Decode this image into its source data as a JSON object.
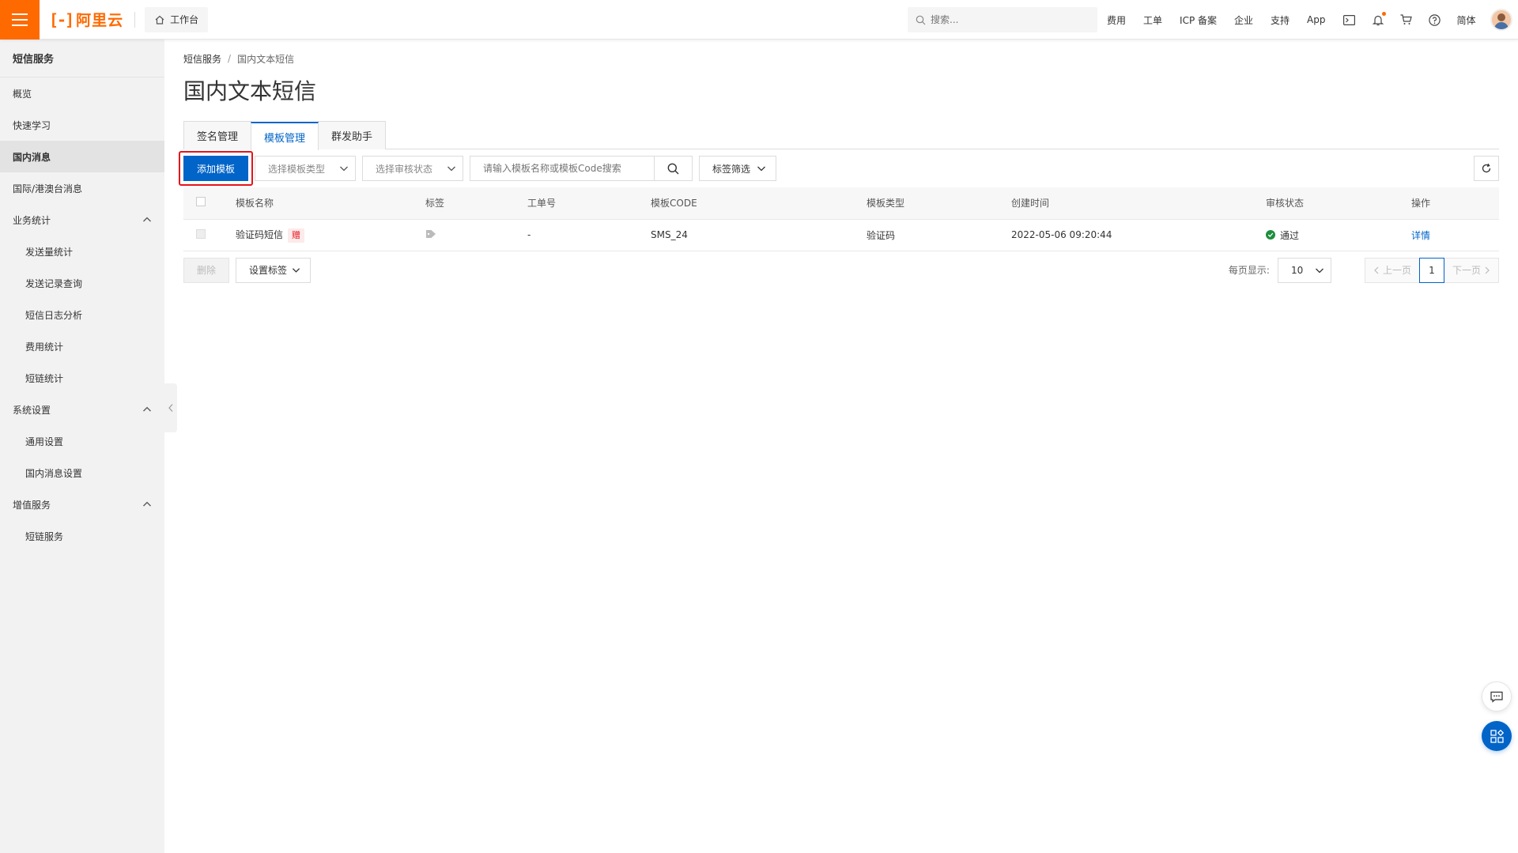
{
  "colors": {
    "brand": "#ff6a00",
    "primary": "#0064c8",
    "highlight": "#e4141c",
    "success": "#1e8e3e"
  },
  "topbar": {
    "logo_mark": "[-]",
    "logo_text": "阿里云",
    "workbench": "工作台",
    "search_placeholder": "搜索...",
    "links": [
      "费用",
      "工单",
      "ICP 备案",
      "企业",
      "支持",
      "App"
    ],
    "icons": [
      "terminal-icon",
      "bell-icon",
      "cart-icon",
      "help-icon"
    ],
    "language": "简体"
  },
  "sidebar": {
    "title": "短信服务",
    "items": [
      {
        "label": "概览",
        "level": 0
      },
      {
        "label": "快速学习",
        "level": 0
      },
      {
        "label": "国内消息",
        "level": 0,
        "active": true
      },
      {
        "label": "国际/港澳台消息",
        "level": 0
      },
      {
        "label": "业务统计",
        "level": 0,
        "expandable": true
      },
      {
        "label": "发送量统计",
        "level": 1
      },
      {
        "label": "发送记录查询",
        "level": 1
      },
      {
        "label": "短信日志分析",
        "level": 1
      },
      {
        "label": "费用统计",
        "level": 1
      },
      {
        "label": "短链统计",
        "level": 1
      },
      {
        "label": "系统设置",
        "level": 0,
        "expandable": true
      },
      {
        "label": "通用设置",
        "level": 1
      },
      {
        "label": "国内消息设置",
        "level": 1
      },
      {
        "label": "增值服务",
        "level": 0,
        "expandable": true
      },
      {
        "label": "短链服务",
        "level": 1
      }
    ]
  },
  "breadcrumb": {
    "root": "短信服务",
    "separator": "/",
    "current": "国内文本短信"
  },
  "page_title": "国内文本短信",
  "tabs": [
    {
      "label": "签名管理",
      "active": false
    },
    {
      "label": "模板管理",
      "active": true
    },
    {
      "label": "群发助手",
      "active": false
    }
  ],
  "toolbar": {
    "add_button": "添加模板",
    "type_select_placeholder": "选择模板类型",
    "status_select_placeholder": "选择审核状态",
    "search_placeholder": "请输入模板名称或模板Code搜索",
    "tag_filter": "标签筛选"
  },
  "table": {
    "columns": [
      "模板名称",
      "标签",
      "工单号",
      "模板CODE",
      "模板类型",
      "创建时间",
      "审核状态",
      "操作"
    ],
    "rows": [
      {
        "name": "验证码短信",
        "badge": "赠",
        "tag_icon": "tag-icon",
        "ticket": "-",
        "code": "SMS_24",
        "type": "验证码",
        "created": "2022-05-06 09:20:44",
        "status": "通过",
        "action": "详情"
      }
    ]
  },
  "footer": {
    "delete_button": "删除",
    "set_tag_button": "设置标签",
    "page_size_label": "每页显示:",
    "page_size": "10",
    "prev": "上一页",
    "current_page": "1",
    "next": "下一页"
  }
}
